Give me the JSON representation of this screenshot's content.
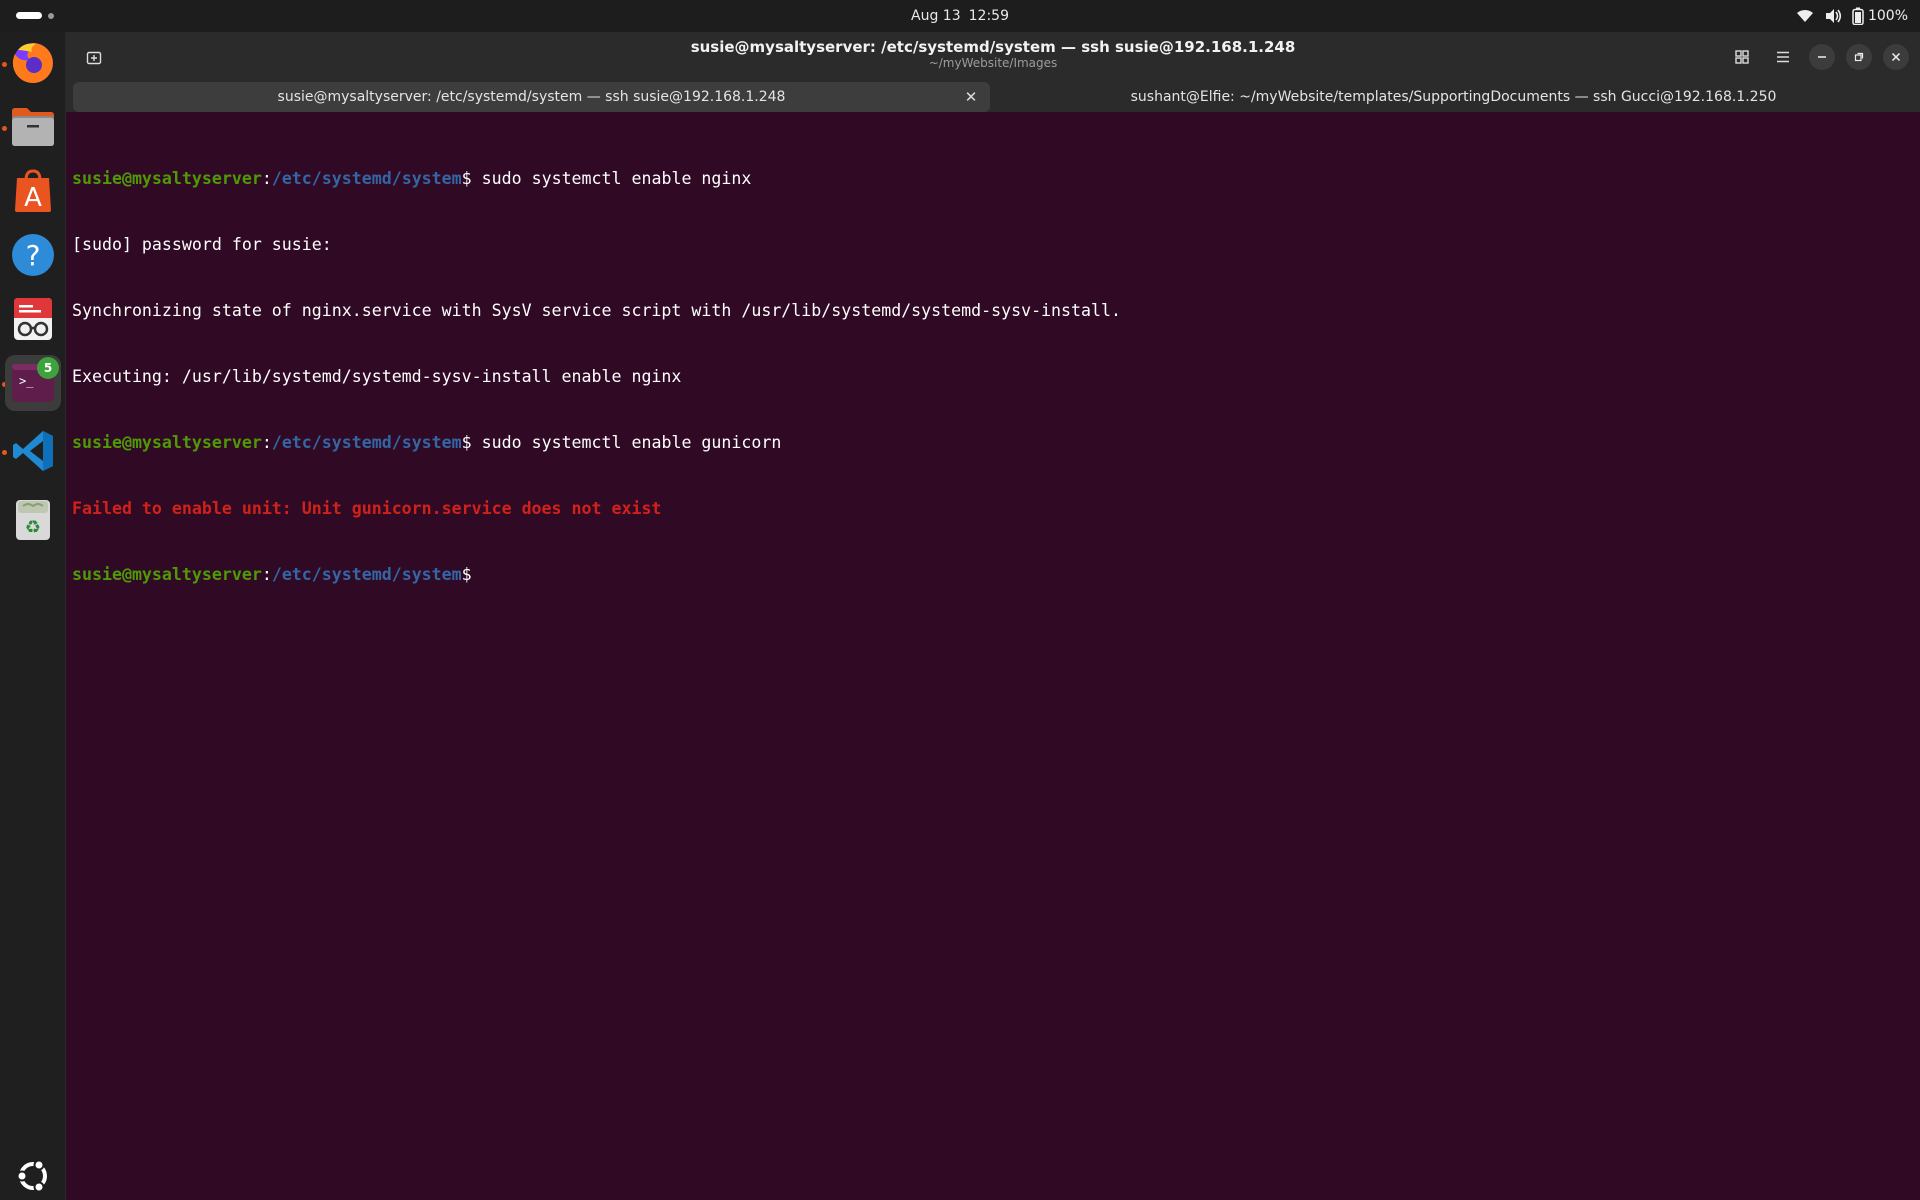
{
  "topbar": {
    "date": "Aug 13",
    "time": "12:59",
    "battery": "100%"
  },
  "dock": {
    "terminal_badge": "5",
    "items": [
      "firefox-icon",
      "files-icon",
      "app-center-icon",
      "help-icon",
      "document-viewer-icon",
      "terminal-icon",
      "vscode-icon",
      "trash-icon",
      "ubuntu-apps-icon"
    ]
  },
  "window": {
    "title": "susie@mysaltyserver: /etc/systemd/system — ssh susie@192.168.1.248",
    "subtitle": "~/myWebsite/Images",
    "tabs": [
      {
        "label": "susie@mysaltyserver: /etc/systemd/system — ssh susie@192.168.1.248",
        "active": true
      },
      {
        "label": "sushant@Elfie: ~/myWebsite/templates/SupportingDocuments — ssh Gucci@192.168.1.250",
        "active": false
      }
    ]
  },
  "terminal": {
    "prompt_user": "susie@mysaltyserver",
    "prompt_sep": ":",
    "prompt_path": "/etc/systemd/system",
    "prompt_dollar": "$",
    "cmd1": " sudo systemctl enable nginx",
    "out1": "[sudo] password for susie:",
    "out2": "Synchronizing state of nginx.service with SysV service script with /usr/lib/systemd/systemd-sysv-install.",
    "out3": "Executing: /usr/lib/systemd/systemd-sysv-install enable nginx",
    "cmd2": " sudo systemctl enable gunicorn",
    "err1": "Failed to enable unit: Unit gunicorn.service does not exist",
    "colors": {
      "background": "#300a24",
      "user": "#4e9a06",
      "path": "#3465a4",
      "error": "#d0211a"
    }
  }
}
